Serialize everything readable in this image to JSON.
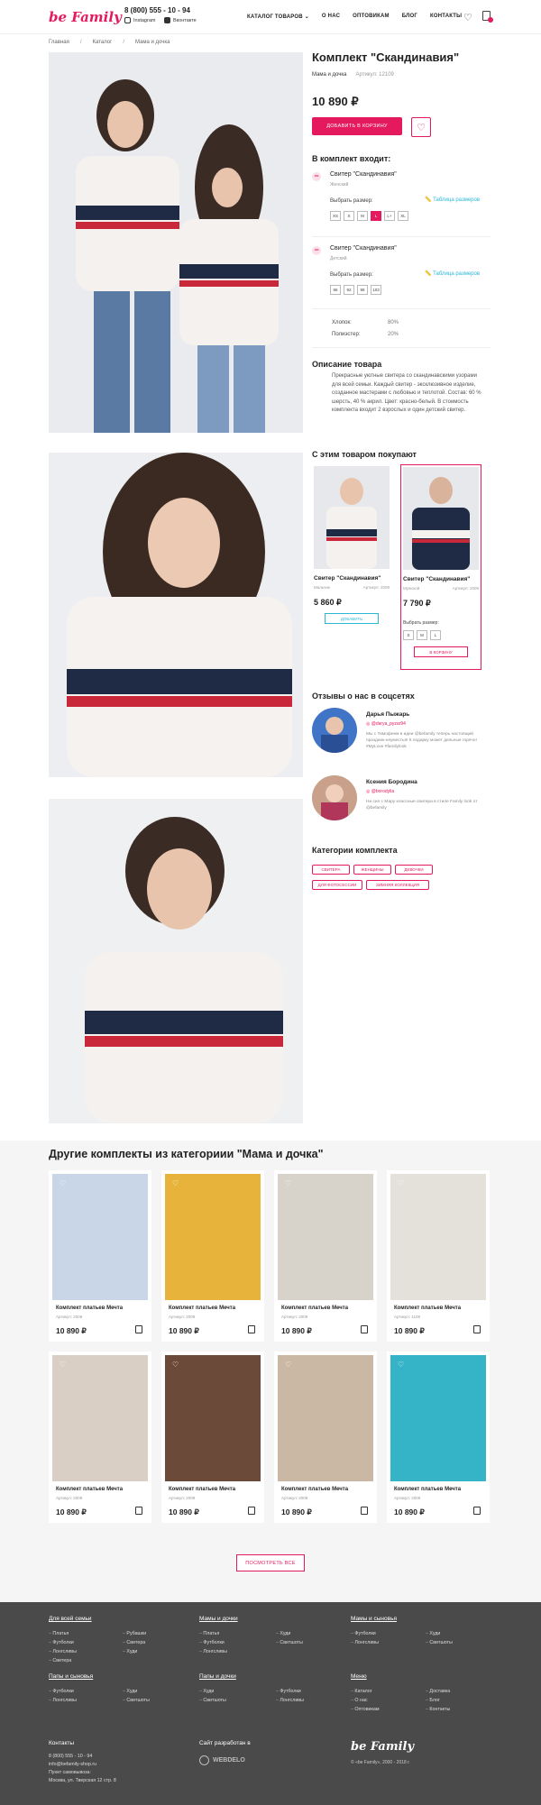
{
  "header": {
    "logo": "be Family",
    "phone": "8 (800) 555 - 10 - 94",
    "instagram": "Instagram",
    "vk": "Вконтакте",
    "nav": [
      "КАТАЛОГ ТОВАРОВ",
      "О НАС",
      "ОПТОВИКАМ",
      "БЛОГ",
      "КОНТАКТЫ"
    ],
    "icons": [
      "heart-icon",
      "bag-icon",
      "chevron-down-icon"
    ],
    "accent": "#e5195e"
  },
  "breadcrumbs": [
    "Главная",
    "Каталог",
    "Мама и дочка"
  ],
  "product": {
    "title": "Комплект \"Скандинавия\"",
    "category": "Мама и дочка",
    "article": "Артикул: 12109",
    "price": "10 890 ₽",
    "add_to_cart": "ДОБАВИТЬ В КОРЗИНУ",
    "kit_heading": "В комплект входит:",
    "items": [
      {
        "name": "Свитер \"Скандинавия\"",
        "type": "Женский",
        "size_label": "Выбрать размер:",
        "table": "Таблица размеров",
        "sizes": [
          "XS",
          "S",
          "M",
          "L",
          "L+",
          "XL"
        ],
        "selected": 3
      },
      {
        "name": "Свитер \"Скандинавия\"",
        "type": "Детский",
        "size_label": "Выбрать размер:",
        "table": "Таблица размеров",
        "sizes": [
          "86",
          "92",
          "98",
          "103"
        ],
        "selected": -1
      }
    ],
    "composition": [
      {
        "name": "Хлопок:",
        "value": "80%"
      },
      {
        "name": "Полиэстер:",
        "value": "20%"
      }
    ],
    "description_heading": "Описание товара",
    "description": "Прекрасные уютные свитера со скандинавскими узорами для всей семьи. Каждый свитер - эксклюзивное изделие, созданное мастерами с любовью и теплотой. Состав: 60 % шерсть, 40 % акрил. Цвет: красно-белый. В стоимость комплекта входит 2 взрослых и один детский свитер."
  },
  "also_buy": {
    "heading": "С этим товаром покупают",
    "items": [
      {
        "name": "Свитер \"Скандинавия\"",
        "type": "Мальчик",
        "article": "Артикул: 2009",
        "price": "5 860 ₽",
        "button": "ДОБАВИТЬ"
      },
      {
        "name": "Свитер \"Скандинавия\"",
        "type": "Мужской",
        "article": "Артикул: 2009",
        "price": "7 790 ₽",
        "size_label": "Выбрать размер:",
        "sizes": [
          "S",
          "M",
          "L"
        ],
        "button": "В КОРЗИНУ"
      }
    ]
  },
  "reviews": {
    "heading": "Отзывы о нас в соцсетях",
    "items": [
      {
        "name": "Дарья Пыжарь",
        "handle": "@darya_pyzar94",
        "text": "Мы с Тимофеем в идеи @befamily теперь настоящий праздник-неуместья! К подарку может дельные горячо! #MyLove #familylook"
      },
      {
        "name": "Ксения Бородина",
        "handle": "@borodylia",
        "text": "Ни сил с Мару классные свитера в стиле Family look от @befamily"
      }
    ]
  },
  "categories": {
    "heading": "Категории комплекта",
    "tags": [
      "СВИТЕРА",
      "ЖЕНЩИНЫ",
      "ДЕВОЧКИ",
      "ДЛЯ ФОТОСЕССИИ",
      "ЗИМНЯЯ КОЛЛЕКЦИЯ"
    ]
  },
  "other": {
    "heading": "Другие комплекты из категориии \"Мама и дочка\"",
    "items": [
      {
        "name": "Комплект платьев Мечта",
        "article": "Артикул: 2009",
        "price": "10 890 ₽",
        "color": "#c9d6e8"
      },
      {
        "name": "Комплект платьев Мечта",
        "article": "Артикул: 2009",
        "price": "10 890 ₽",
        "color": "#e7b33b"
      },
      {
        "name": "Комплект платьев Мечта",
        "article": "Артикул: 2009",
        "price": "10 890 ₽",
        "color": "#d8d3ca"
      },
      {
        "name": "Комплект платьев Мечта",
        "article": "Артикул: 1109",
        "price": "10 890 ₽",
        "color": "#e4e1db"
      },
      {
        "name": "Комплект платьев Мечта",
        "article": "Артикул: 2009",
        "price": "10 890 ₽",
        "color": "#d9cfc4"
      },
      {
        "name": "Комплект платьев Мечта",
        "article": "Артикул: 2009",
        "price": "10 890 ₽",
        "color": "#6b4a3a"
      },
      {
        "name": "Комплект платьев Мечта",
        "article": "Артикул: 2009",
        "price": "10 890 ₽",
        "color": "#cbb8a4"
      },
      {
        "name": "Комплект платьев Мечта",
        "article": "Артикул: 2009",
        "price": "10 890 ₽",
        "color": "#35b3c7"
      }
    ],
    "more": "ПОСМОТРЕТЬ ВСЕ"
  },
  "footer": {
    "col1_h": "Для всей семьи",
    "col1a": [
      "Платья",
      "Футболки",
      "Лонгсливы",
      "Свитера"
    ],
    "col1b": [
      "Рубашки",
      "Свитера",
      "Худи"
    ],
    "col2_h": "Мамы и дочки",
    "col2a": [
      "Платья",
      "Футболки",
      "Лонгсливы"
    ],
    "col2b": [
      "Худи",
      "Свитшоты"
    ],
    "col3_h": "Мамы и сыновья",
    "col3a": [
      "Футболки",
      "Лонгсливы"
    ],
    "col3b": [
      "Худи",
      "Свитшоты"
    ],
    "col4_h": "Папы и сыновья",
    "col4a": [
      "Футболки",
      "Лонгсливы"
    ],
    "col4b": [
      "Худи",
      "Свитшоты"
    ],
    "col5_h": "Папы и дочки",
    "col5a": [
      "Худи",
      "Свитшоты"
    ],
    "col5b": [
      "Футболки",
      "Лонгсливы"
    ],
    "col6_h": "Меню",
    "col6a": [
      "Каталог",
      "О нас",
      "Оптовикам"
    ],
    "col6b": [
      "Доставка",
      "Блог",
      "Контакты"
    ],
    "contacts_h": "Контакты",
    "contacts": [
      "8 (800) 555 - 10 - 94",
      "info@befamily-shop.ru",
      "Пункт самовывоза:",
      "Москва, ул. Тверская 12 стр. 8"
    ],
    "dev_h": "Сайт разработан в",
    "dev": "WEBDELO",
    "logo": "be Family",
    "copyright": "«be Family», 2000 - 2018 г."
  }
}
